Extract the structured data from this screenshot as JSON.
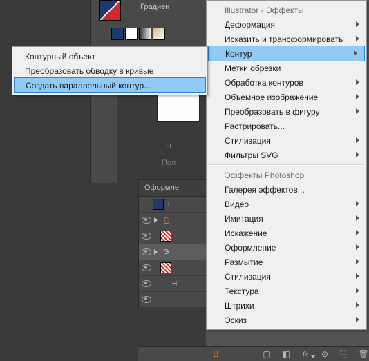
{
  "swatch": {
    "gradient_label": "Градиен"
  },
  "preview": {
    "label_w": "Н",
    "label_pts": "Пол"
  },
  "appearance": {
    "title": "Оформле",
    "row_t": "Т",
    "row_c": "С",
    "row_e": "Э",
    "row_h": "Н"
  },
  "bottom": {
    "link": "Н"
  },
  "submenu": {
    "outline_object": "Контурный объект",
    "outline_stroke": "Преобразовать обводку в кривые",
    "offset_path": "Создать параллельный контур..."
  },
  "menu": {
    "header_illustrator": "Illustrator - Эффекты",
    "warp": "Деформация",
    "distort": "Исказить и трансформировать",
    "path": "Контур",
    "crop_marks": "Метки обрезки",
    "pathfinder": "Обработка контуров",
    "volumetric": "Объемное изображение",
    "convert_shape": "Преобразовать в фигуру",
    "rasterize": "Растрировать...",
    "stylize": "Стилизация",
    "svg_filters": "Фильтры SVG",
    "header_photoshop": "Эффекты Photoshop",
    "effect_gallery": "Галерея эффектов...",
    "video": "Видео",
    "imitation": "Имитация",
    "distortion": "Искажение",
    "appearance2": "Оформление",
    "blur": "Размытие",
    "stylize2": "Стилизация",
    "texture": "Текстура",
    "strokes": "Штрихи",
    "sketch": "Эскиз"
  }
}
